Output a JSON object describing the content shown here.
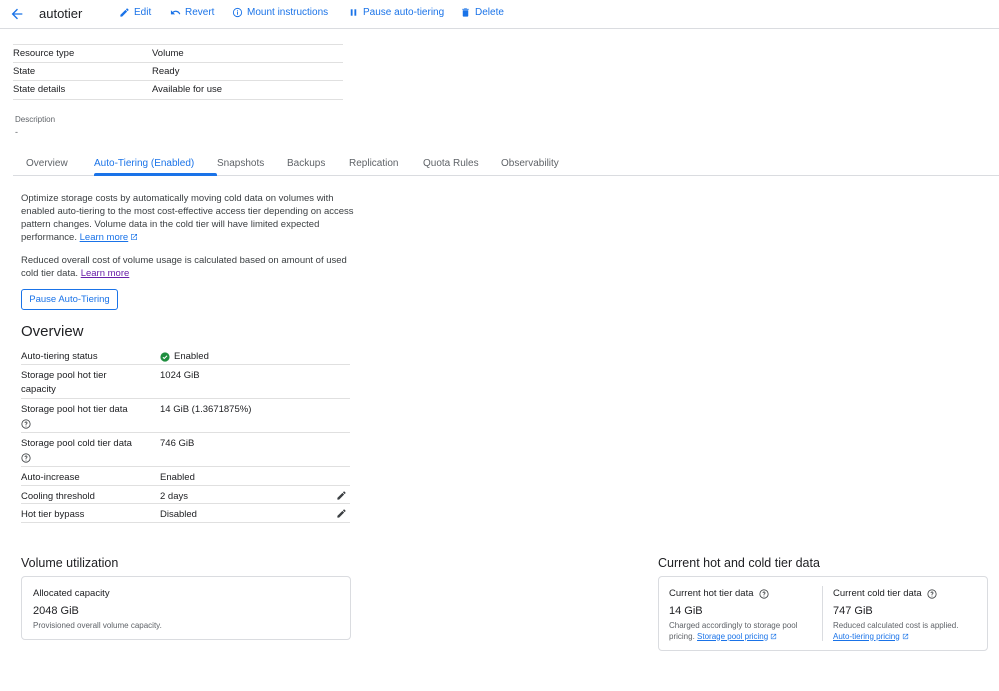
{
  "header": {
    "title": "autotier",
    "actions": {
      "edit": "Edit",
      "revert": "Revert",
      "mount": "Mount instructions",
      "pause": "Pause auto-tiering",
      "delete": "Delete"
    }
  },
  "details": [
    {
      "key": "Resource type",
      "value": "Volume"
    },
    {
      "key": "State",
      "value": "Ready"
    },
    {
      "key": "State details",
      "value": "Available for use"
    }
  ],
  "description": {
    "label": "Description",
    "value": "-"
  },
  "tabs": [
    "Overview",
    "Auto-Tiering (Enabled)",
    "Snapshots",
    "Backups",
    "Replication",
    "Quota Rules",
    "Observability"
  ],
  "intro": {
    "p1": "Optimize storage costs by automatically moving cold data on volumes with enabled auto-tiering to the most cost-effective access tier depending on access pattern changes. Volume data in the cold tier will have limited expected performance.",
    "p1_link": "Learn more",
    "p2": "Reduced overall cost of volume usage is calculated based on amount of used cold tier data.",
    "p2_link": "Learn more"
  },
  "pause_button": "Pause Auto-Tiering",
  "overview": {
    "title": "Overview",
    "rows": [
      {
        "key": "Auto-tiering status",
        "value": "Enabled"
      },
      {
        "key": "Storage pool hot tier capacity",
        "value": "1024 GiB"
      },
      {
        "key": "Storage pool hot tier data",
        "value": "14 GiB (1.3671875%)"
      },
      {
        "key": "Storage pool cold tier data",
        "value": "746 GiB"
      },
      {
        "key": "Auto-increase",
        "value": "Enabled"
      },
      {
        "key": "Cooling threshold",
        "value": "2 days"
      },
      {
        "key": "Hot tier bypass",
        "value": "Disabled"
      }
    ]
  },
  "utilization": {
    "title": "Volume utilization",
    "card_title": "Allocated capacity",
    "value": "2048 GiB",
    "sub": "Provisioned overall volume capacity."
  },
  "tier_data": {
    "title": "Current hot and cold tier data",
    "hot": {
      "title": "Current hot tier data",
      "value": "14 GiB",
      "sub": "Charged accordingly to storage pool pricing.",
      "link": "Storage pool pricing"
    },
    "cold": {
      "title": "Current cold tier data",
      "value": "747 GiB",
      "sub": "Reduced calculated cost is applied.",
      "link": "Auto-tiering pricing"
    }
  },
  "colors": {
    "accent": "#1a73e8",
    "success": "#1e8e3e",
    "visited_link": "#681da8"
  }
}
